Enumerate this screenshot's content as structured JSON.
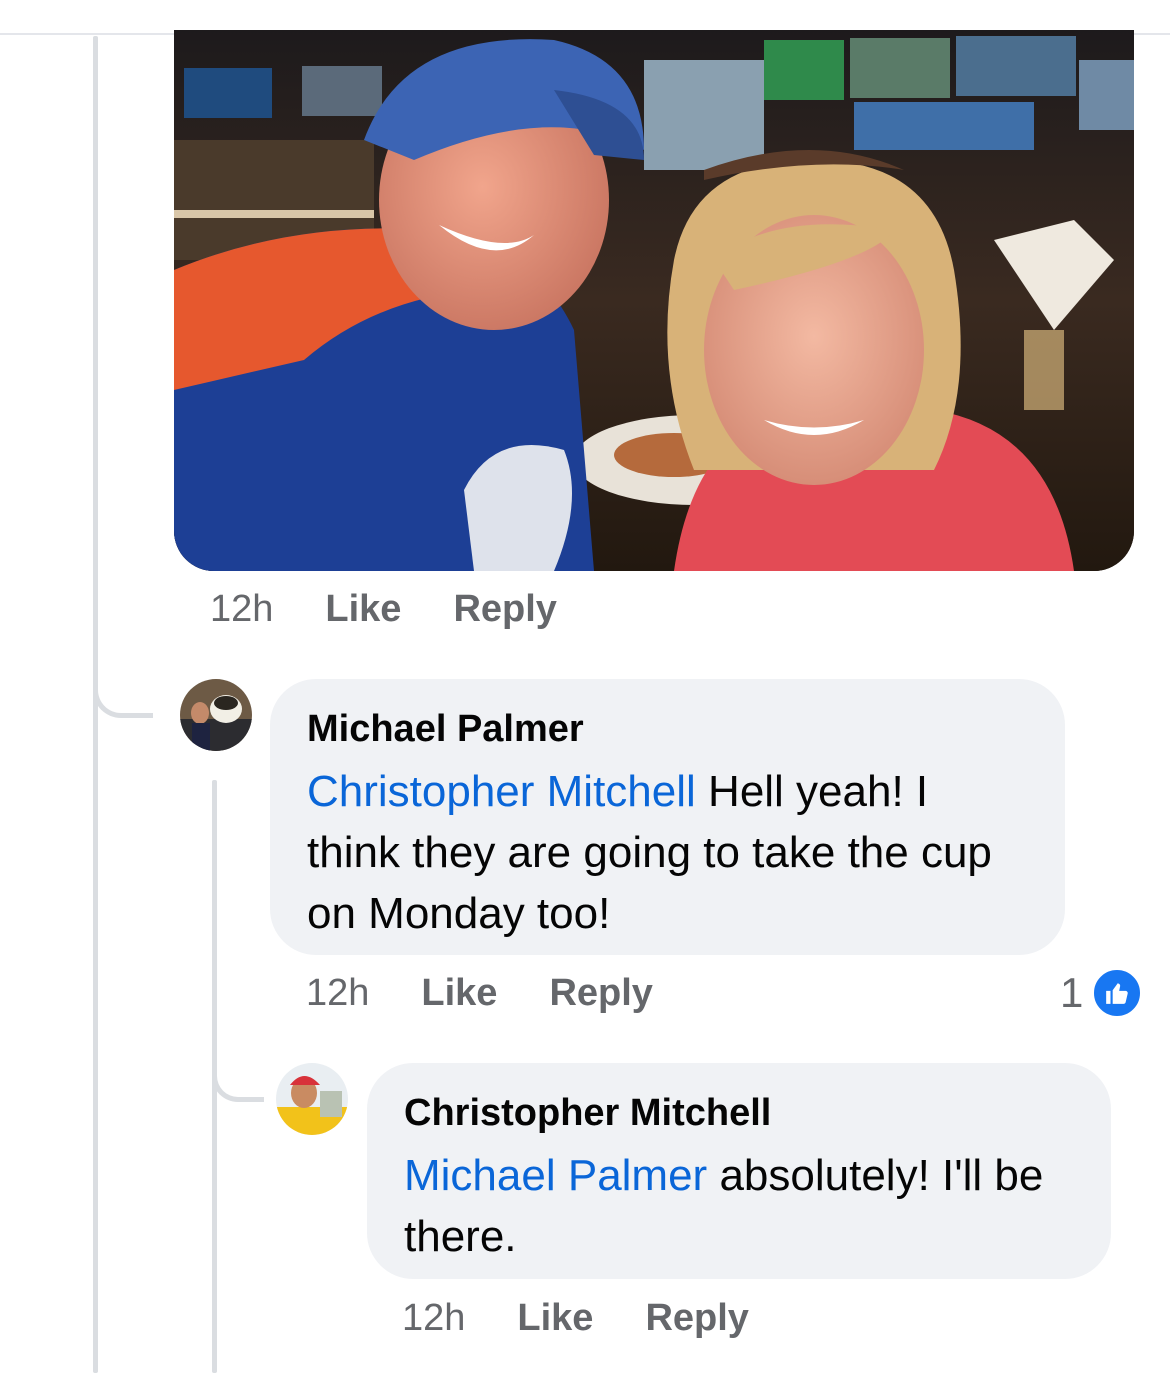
{
  "post_photo": {
    "alt": "photo"
  },
  "comment_photo": {
    "time": "12h",
    "like": "Like",
    "reply": "Reply"
  },
  "comment_1": {
    "author": "Michael Palmer",
    "mention": "Christopher Mitchell",
    "text": " Hell yeah! I think they are going to take the cup on Monday too!",
    "time": "12h",
    "like": "Like",
    "reply": "Reply",
    "reaction_count": "1"
  },
  "comment_2": {
    "author": "Christopher Mitchell",
    "mention": "Michael Palmer",
    "text": " absolutely! I'll be there.",
    "time": "12h",
    "like": "Like",
    "reply": "Reply"
  },
  "colors": {
    "link": "#0a66d8",
    "bubble": "#f0f2f5",
    "meta": "#65676b",
    "like_blue": "#1877f2"
  },
  "icons": {
    "reaction": "thumbs-up-icon"
  }
}
